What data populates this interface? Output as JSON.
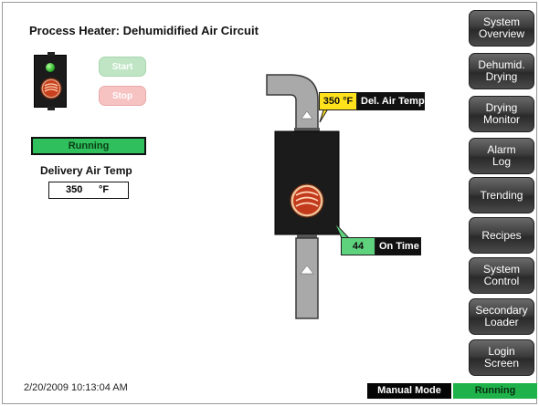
{
  "header": {
    "title": "Process Heater: Dehumidified Air Circuit"
  },
  "controls": {
    "start_label": "Start",
    "stop_label": "Stop",
    "status_text": "Running"
  },
  "delivery_air": {
    "label": "Delivery Air Temp",
    "value": "350",
    "unit": "°F"
  },
  "diagram": {
    "del_air_temp_value": "350 °F",
    "del_air_temp_label": "Del. Air Temp",
    "on_time_value": "44",
    "on_time_label": "On Time"
  },
  "nav": {
    "items": [
      {
        "label": "System\nOverview"
      },
      {
        "label": "Dehumid.\nDrying"
      },
      {
        "label": "Drying\nMonitor"
      },
      {
        "label": "Alarm\nLog"
      },
      {
        "label": "Trending"
      },
      {
        "label": "Recipes"
      },
      {
        "label": "System\nControl"
      },
      {
        "label": "Secondary\nLoader"
      },
      {
        "label": "Login\nScreen"
      }
    ]
  },
  "footer": {
    "timestamp": "2/20/2009 10:13:04 AM",
    "mode": "Manual Mode",
    "state": "Running"
  },
  "colors": {
    "running_green": "#2fbf5c",
    "callout_yellow": "#ffe21c",
    "start_soft": "#bfe5c4",
    "stop_soft": "#f6c2c2"
  }
}
